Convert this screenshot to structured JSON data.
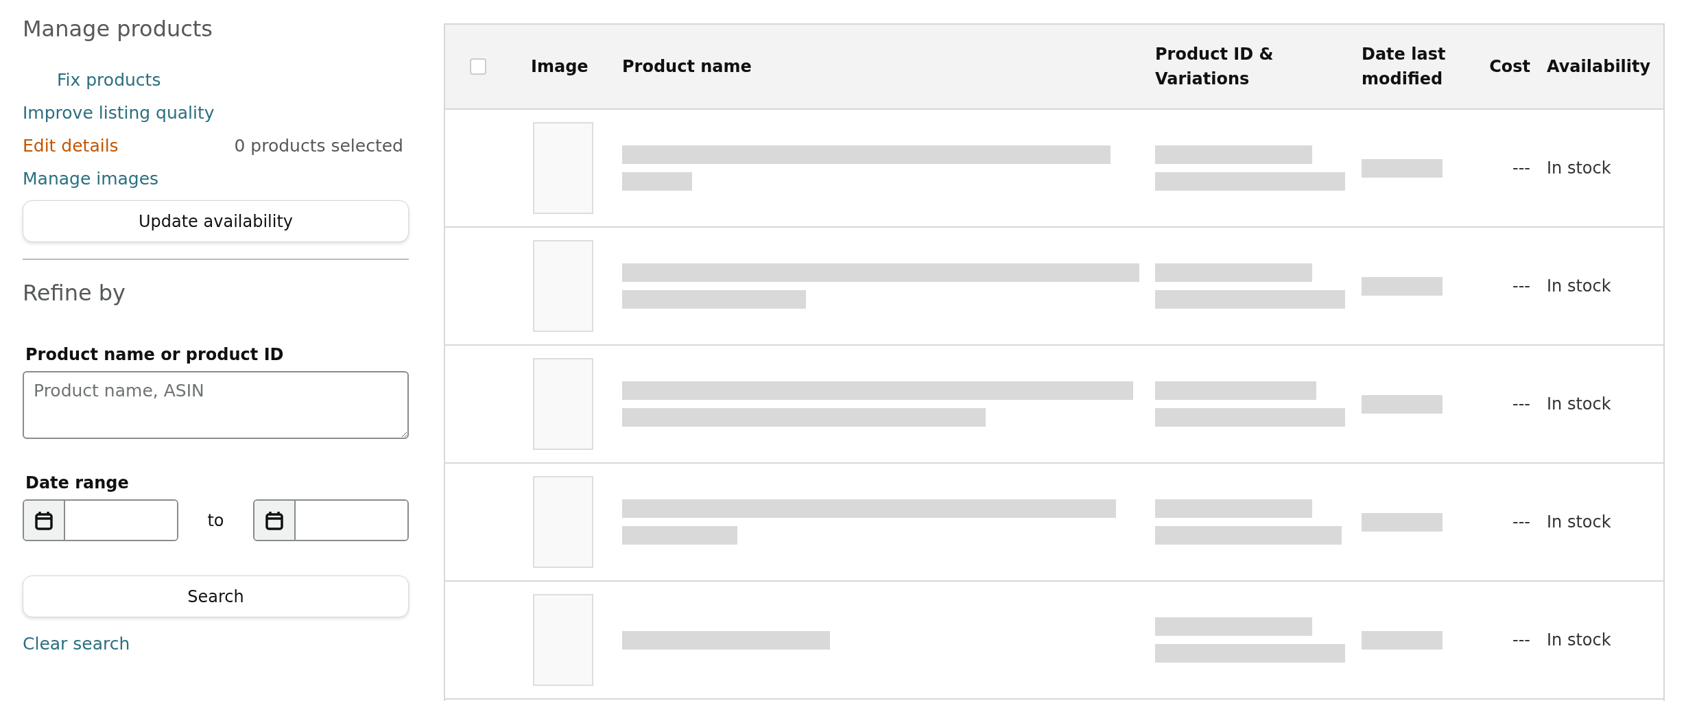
{
  "sidebar": {
    "title": "Manage products",
    "actions": [
      {
        "label": "Fix products",
        "kind": "sub",
        "active": false
      },
      {
        "label": "Improve listing quality",
        "kind": "link",
        "active": false
      },
      {
        "label": "Edit details",
        "kind": "link",
        "active": true
      },
      {
        "label": "Manage images",
        "kind": "link",
        "active": false
      }
    ],
    "selection_count": "0 products selected",
    "update_button": "Update availability",
    "refine_title": "Refine by",
    "search_field": {
      "label": "Product name or product ID",
      "placeholder": "Product name, ASIN"
    },
    "date_range": {
      "label": "Date range",
      "separator": "to"
    },
    "search_button": "Search",
    "clear_link": "Clear search"
  },
  "table": {
    "select_all": {
      "checked": false
    },
    "columns": [
      "Image",
      "Product name",
      "Product ID & Variations",
      "Date last modified",
      "Cost",
      "Availability"
    ],
    "rows": [
      {
        "cost": "---",
        "availability": "In stock"
      },
      {
        "cost": "---",
        "availability": "In stock"
      },
      {
        "cost": "---",
        "availability": "In stock"
      },
      {
        "cost": "---",
        "availability": "In stock"
      },
      {
        "cost": "---",
        "availability": "In stock"
      }
    ]
  }
}
